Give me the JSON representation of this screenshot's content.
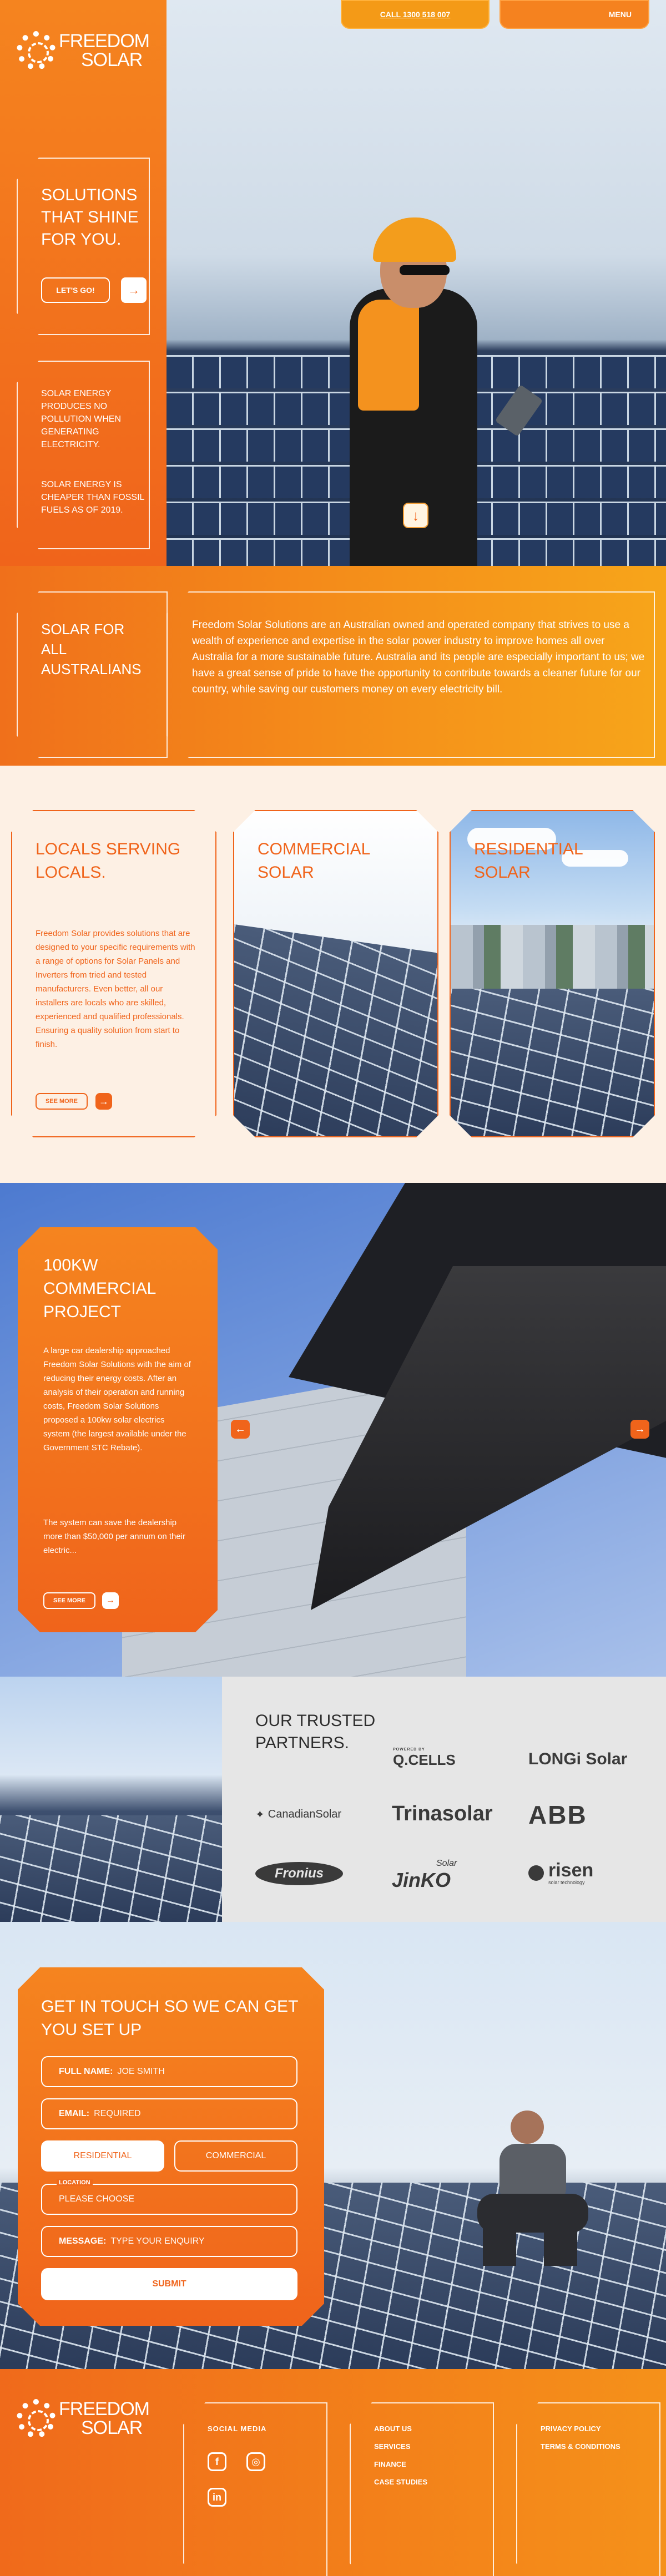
{
  "brand": {
    "logo_line1": "FREEDOM",
    "logo_line2": "SOLAR"
  },
  "header": {
    "call_label": "CALL 1300 518 007",
    "menu_label": "MENU"
  },
  "hero": {
    "title": "SOLUTIONS THAT SHINE FOR YOU.",
    "cta_label": "LET'S GO!",
    "fact1": "SOLAR ENERGY PRODUCES NO POLLUTION WHEN GENERATING ELECTRICITY.",
    "fact2": "SOLAR ENERGY IS CHEAPER THAN FOSSIL FUELS AS OF 2019."
  },
  "about": {
    "title": "SOLAR FOR ALL AUSTRALIANS",
    "text": "Freedom Solar Solutions are an Australian owned and operated company that strives to use a wealth of experience and expertise in the solar power industry to improve homes all over Australia for a more sustainable future. Australia and its people are especially important to us; we have a great sense of pride to have the opportunity to contribute towards a cleaner future for our country, while saving our customers money on every electricity bill."
  },
  "cards": {
    "locals": {
      "title": "LOCALS SERVING LOCALS.",
      "text": "Freedom Solar provides solutions that are designed to your specific requirements with a range of options for Solar Panels and Inverters from tried and tested manufacturers. Even better, all our installers are locals who are skilled, experienced and qualified professionals. Ensuring a quality solution from start to finish.",
      "button_label": "SEE MORE"
    },
    "commercial": {
      "title": "COMMERCIAL SOLAR"
    },
    "residential": {
      "title": "RESIDENTIAL SOLAR"
    }
  },
  "project": {
    "title": "100KW COMMERCIAL PROJECT",
    "text1": "A large car dealership approached Freedom Solar Solutions with the aim of reducing their energy costs. After an analysis of their operation and running costs, Freedom Solar Solutions proposed a 100kw solar electrics system (the largest available under the Government STC Rebate).",
    "text2": "The system can save the dealership more than $50,000 per annum on their electric...",
    "button_label": "SEE MORE"
  },
  "partners": {
    "title": "OUR TRUSTED PARTNERS.",
    "logos": {
      "qcells_small": "POWERED BY",
      "qcells": "Q.CELLS",
      "longi": "LONGi Solar",
      "canadian": "CanadianSolar",
      "trina": "Trinasolar",
      "abb": "ABB",
      "fronius": "Fronius",
      "jinko": "JinKO",
      "jinko_small": "Solar",
      "risen": "risen",
      "risen_small": "solar technology"
    }
  },
  "contact": {
    "title": "GET IN TOUCH SO WE CAN GET YOU SET UP",
    "name_label": "FULL NAME:",
    "name_value": "JOE SMITH",
    "email_label": "EMAIL:",
    "email_value": "REQUIRED",
    "residential_label": "RESIDENTIAL",
    "commercial_label": "COMMERCIAL",
    "location_label": "LOCATION",
    "location_value": "PLEASE CHOOSE",
    "message_label": "MESSAGE:",
    "message_value": "TYPE YOUR ENQUIRY",
    "submit_label": "SUBMIT"
  },
  "footer": {
    "social_label": "SOCIAL MEDIA",
    "links_col1": [
      "ABOUT US",
      "SERVICES",
      "FINANCE",
      "CASE STUDIES"
    ],
    "links_col2": [
      "PRIVACY POLICY",
      "TERMS & CONDITIONS"
    ]
  },
  "colors": {
    "accent": "#f0641b",
    "accent_light": "#f5921a",
    "cream": "#fdf0e4",
    "partner_bg": "#e6e6e6"
  }
}
